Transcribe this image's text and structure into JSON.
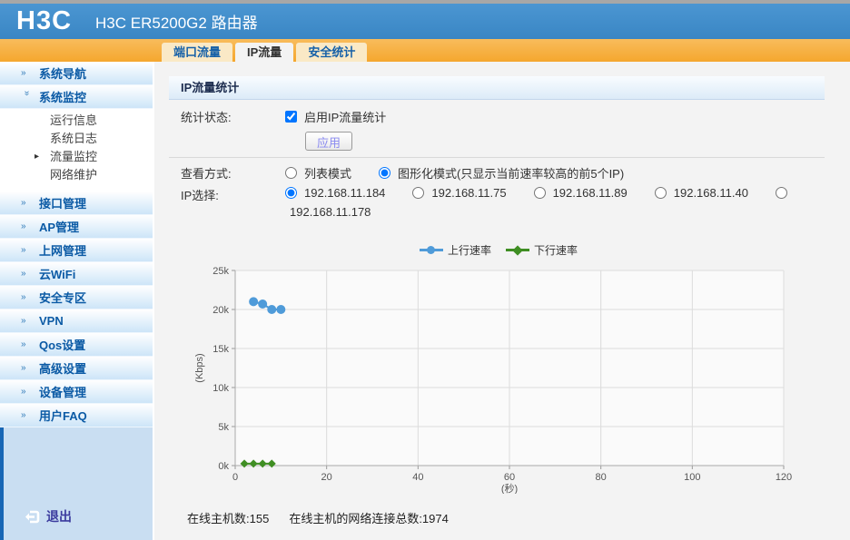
{
  "header": {
    "logo": "H3C",
    "title": "H3C ER5200G2 路由器"
  },
  "tabs": [
    {
      "label": "端口流量",
      "active": false
    },
    {
      "label": "IP流量",
      "active": true
    },
    {
      "label": "安全统计",
      "active": false
    }
  ],
  "sidebar": {
    "top": [
      {
        "label": "系统导航"
      },
      {
        "label": "系统监控"
      }
    ],
    "submenu": [
      {
        "label": "运行信息",
        "active": false
      },
      {
        "label": "系统日志",
        "active": false
      },
      {
        "label": "流量监控",
        "active": true
      },
      {
        "label": "网络维护",
        "active": false
      }
    ],
    "groups": [
      {
        "label": "接口管理"
      },
      {
        "label": "AP管理"
      },
      {
        "label": "上网管理"
      },
      {
        "label": "云WiFi"
      },
      {
        "label": "安全专区"
      },
      {
        "label": "VPN"
      },
      {
        "label": "Qos设置"
      },
      {
        "label": "高级设置"
      },
      {
        "label": "设备管理"
      },
      {
        "label": "用户FAQ"
      }
    ],
    "logout": "退出"
  },
  "panel": {
    "title": "IP流量统计",
    "stats": {
      "label": "统计状态:",
      "checkbox_label": "启用IP流量统计",
      "checked": true,
      "apply_label": "应用"
    },
    "view": {
      "label": "查看方式:",
      "options": [
        {
          "label": "列表模式",
          "selected": false
        },
        {
          "label": "图形化模式(只显示当前速率较高的前5个IP)",
          "selected": true
        }
      ]
    },
    "ip": {
      "label": "IP选择:",
      "options": [
        {
          "label": "192.168.11.184",
          "selected": true
        },
        {
          "label": "192.168.11.75",
          "selected": false
        },
        {
          "label": "192.168.11.89",
          "selected": false
        },
        {
          "label": "192.168.11.40",
          "selected": false
        },
        {
          "label": "192.168.11.178",
          "selected": false
        }
      ]
    }
  },
  "footer": {
    "online_hosts": "在线主机数:155",
    "total_connections": "在线主机的网络连接总数:1974"
  },
  "chart_data": {
    "type": "line",
    "series": [
      {
        "name": "上行速率",
        "color": "#4f9bd9",
        "marker": "circle",
        "points": [
          [
            4,
            21000
          ],
          [
            6,
            20700
          ],
          [
            8,
            20000
          ],
          [
            10,
            20000
          ]
        ]
      },
      {
        "name": "下行速率",
        "color": "#3f8e23",
        "marker": "diamond",
        "points": [
          [
            2,
            250
          ],
          [
            4,
            250
          ],
          [
            6,
            250
          ],
          [
            8,
            250
          ]
        ]
      }
    ],
    "xlabel": "(秒)",
    "ylabel": "(Kbps)",
    "xlim": [
      0,
      120
    ],
    "ylim": [
      0,
      25000
    ],
    "xticks": [
      0,
      20,
      40,
      60,
      80,
      100,
      120
    ],
    "yticks": [
      {
        "v": 0,
        "t": "0k"
      },
      {
        "v": 5000,
        "t": "5k"
      },
      {
        "v": 10000,
        "t": "10k"
      },
      {
        "v": 15000,
        "t": "15k"
      },
      {
        "v": 20000,
        "t": "20k"
      },
      {
        "v": 25000,
        "t": "25k"
      }
    ],
    "grid": true,
    "legend_position": "top"
  }
}
